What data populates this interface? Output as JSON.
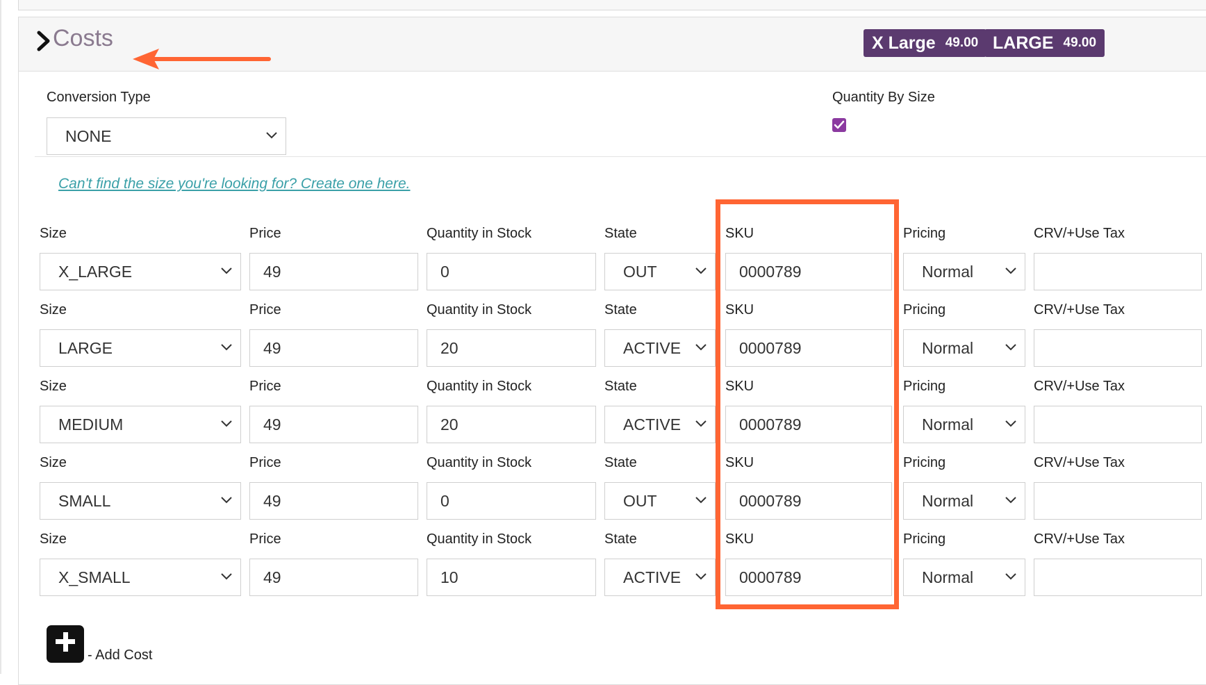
{
  "header": {
    "section_title": "Costs",
    "badges": [
      {
        "name": "X Large",
        "value": "49.00"
      },
      {
        "name": "LARGE",
        "value": "49.00"
      }
    ]
  },
  "settings": {
    "conversion_type_label": "Conversion Type",
    "conversion_type_value": "NONE",
    "quantity_by_size_label": "Quantity By Size",
    "quantity_by_size_checked": true
  },
  "create_size_link": "Can't find the size you're looking for? Create one here.",
  "column_labels": {
    "size": "Size",
    "price": "Price",
    "quantity": "Quantity in Stock",
    "state": "State",
    "sku": "SKU",
    "pricing": "Pricing",
    "tax": "CRV/+Use Tax"
  },
  "rows": [
    {
      "size": "X_LARGE",
      "price": "49",
      "quantity": "0",
      "state": "OUT",
      "sku": "0000789",
      "pricing": "Normal",
      "tax": ""
    },
    {
      "size": "LARGE",
      "price": "49",
      "quantity": "20",
      "state": "ACTIVE",
      "sku": "0000789",
      "pricing": "Normal",
      "tax": ""
    },
    {
      "size": "MEDIUM",
      "price": "49",
      "quantity": "20",
      "state": "ACTIVE",
      "sku": "0000789",
      "pricing": "Normal",
      "tax": ""
    },
    {
      "size": "SMALL",
      "price": "49",
      "quantity": "0",
      "state": "OUT",
      "sku": "0000789",
      "pricing": "Normal",
      "tax": ""
    },
    {
      "size": "X_SMALL",
      "price": "49",
      "quantity": "10",
      "state": "ACTIVE",
      "sku": "0000789",
      "pricing": "Normal",
      "tax": ""
    }
  ],
  "add_cost_label": "- Add Cost",
  "colors": {
    "badge_bg": "#5b3a6f",
    "annotation": "#ff6533",
    "checkbox": "#8b3aa0",
    "link": "#3aa0a8"
  },
  "icons": {
    "expand": "chevron-right-icon",
    "dropdown": "chevron-down-icon",
    "add": "plus-square-icon",
    "annotation_arrow": "arrow-left-icon"
  }
}
